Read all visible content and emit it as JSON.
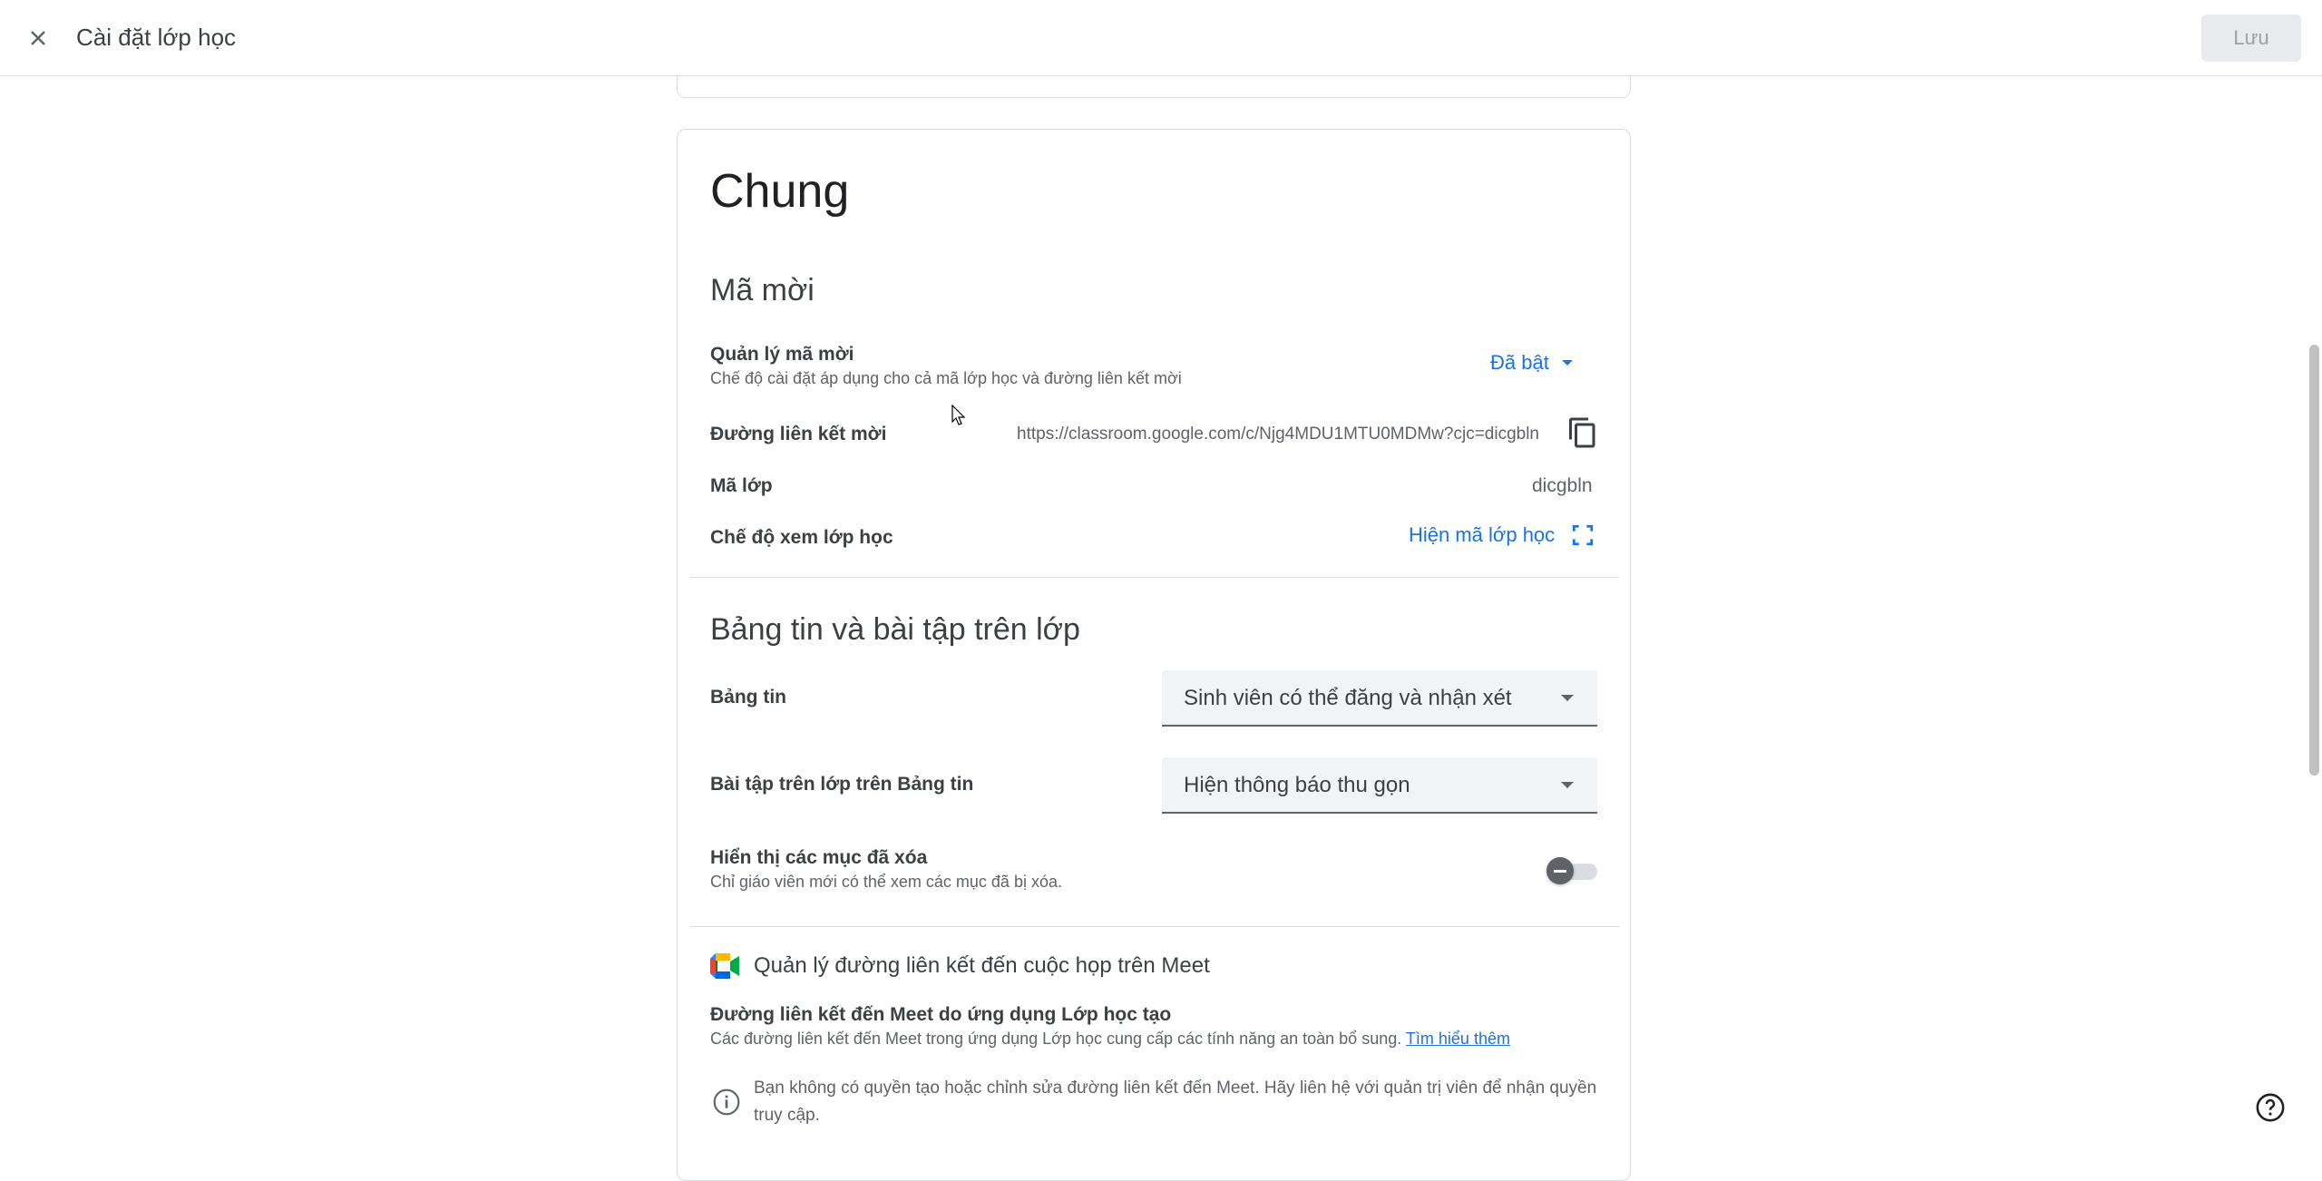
{
  "header": {
    "title": "Cài đặt lớp học",
    "save_label": "Lưu"
  },
  "general": {
    "title": "Chung",
    "invite": {
      "section_title": "Mã mời",
      "manage_label": "Quản lý mã mời",
      "manage_desc": "Chế độ cài đặt áp dụng cho cả mã lớp học và đường liên kết mời",
      "manage_value": "Đã bật",
      "link_label": "Đường liên kết mời",
      "link_value": "https://classroom.google.com/c/Njg4MDU1MTU0MDMw?cjc=dicgbln",
      "code_label": "Mã lớp",
      "code_value": "dicgbln",
      "view_label": "Chế độ xem lớp học",
      "view_action": "Hiện mã lớp học"
    },
    "stream": {
      "section_title": "Bảng tin và bài tập trên lớp",
      "stream_label": "Bảng tin",
      "stream_value": "Sinh viên có thể đăng và nhận xét",
      "classwork_label": "Bài tập trên lớp trên Bảng tin",
      "classwork_value": "Hiện thông báo thu gọn",
      "deleted_label": "Hiển thị các mục đã xóa",
      "deleted_desc": "Chỉ giáo viên mới có thể xem các mục đã bị xóa.",
      "deleted_enabled": false
    },
    "meet": {
      "section_title": "Quản lý đường liên kết đến cuộc họp trên Meet",
      "generated_label": "Đường liên kết đến Meet do ứng dụng Lớp học tạo",
      "generated_desc": "Các đường liên kết đến Meet trong ứng dụng Lớp học cung cấp các tính năng an toàn bổ sung.",
      "learn_more": "Tìm hiểu thêm",
      "notice": "Bạn không có quyền tạo hoặc chỉnh sửa đường liên kết đến Meet. Hãy liên hệ với quản trị viên để nhận quyền truy cập."
    }
  },
  "colors": {
    "accent": "#1a73e8",
    "text": "#202124",
    "muted": "#5f6368",
    "border": "#dadce0"
  },
  "icons": [
    "close-icon",
    "copy-icon",
    "fullscreen-icon",
    "meet-icon",
    "info-icon",
    "help-icon",
    "caret-down-icon"
  ]
}
